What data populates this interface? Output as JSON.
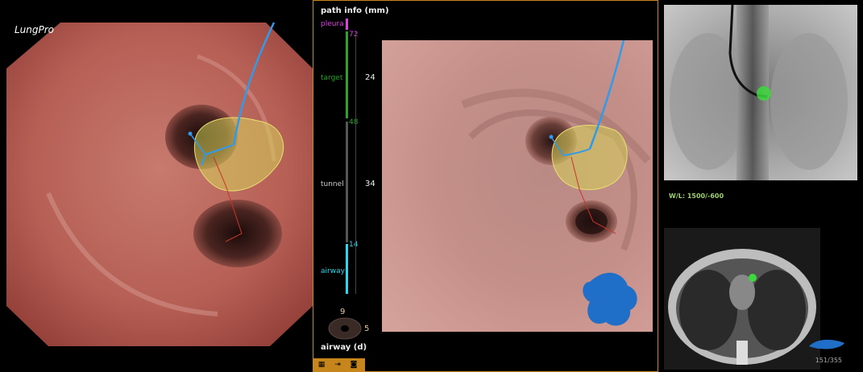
{
  "app": {
    "logo": "LungPro"
  },
  "path_info": {
    "title": "path info (mm)",
    "pleura": {
      "label": "pleura",
      "value": "72",
      "color": "#e040e0"
    },
    "target": {
      "label": "target",
      "value": "24",
      "mark": "48",
      "color": "#2aa52a"
    },
    "tunnel": {
      "label": "tunnel",
      "value": "34",
      "color": "#cccccc"
    },
    "airway": {
      "label": "airway",
      "value": "14",
      "color": "#2ad8f0"
    },
    "airway_d": {
      "label": "airway (d)",
      "top": "9",
      "right": "5"
    }
  },
  "toolbar": {
    "icons": [
      "grid-icon",
      "login-icon",
      "camera-icon"
    ]
  },
  "fluoro": {
    "wl": "W/L: 1500/-600"
  },
  "ct": {
    "slice": "151/355"
  }
}
